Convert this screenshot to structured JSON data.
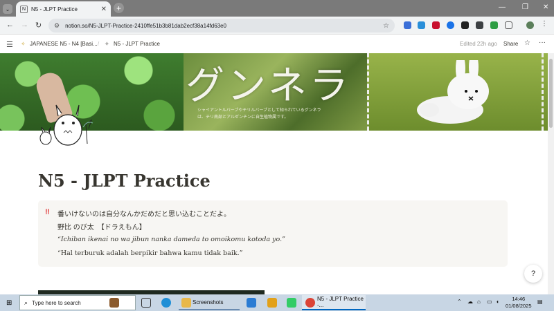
{
  "browser": {
    "tab_title": "N5 - JLPT Practice",
    "url": "notion.so/N5-JLPT-Practice-2410ffe51b3b81dab2ecf38a14fd63e0"
  },
  "notion_header": {
    "breadcrumb_parent": "JAPANESE N5 - N4 [Basi...",
    "breadcrumb_sep": "/",
    "breadcrumb_current": "N5 - JLPT Practice",
    "edited": "Edited 22h ago",
    "share_label": "Share"
  },
  "cover": {
    "headline": "グンネラ",
    "caption_line1": "シャイアントルバーブやチリルバーブとして知られているグンネラ",
    "caption_line2": "は、チリ南部とアルゼンチンに自生植物属です。"
  },
  "page": {
    "title": "N5 - JLPT Practice",
    "callout": {
      "icon": "‼",
      "line1": "番いけないのは自分なんかだめだと思い込むことだよ。",
      "line2": "野比 のび太　【ドラえもん】",
      "line3": "“Ichiban ikenai no wa jibun nanka dameda to omoikomu kotoda yo.”",
      "line4": "“Hal terburuk adalah berpikir bahwa kamu tidak baik.”"
    }
  },
  "taskbar": {
    "search_placeholder": "Type here to search",
    "app_explorer": "Screenshots",
    "app_chrome": "N5 - JLPT Practice -...",
    "time": "14:46",
    "date": "01/08/2025"
  }
}
